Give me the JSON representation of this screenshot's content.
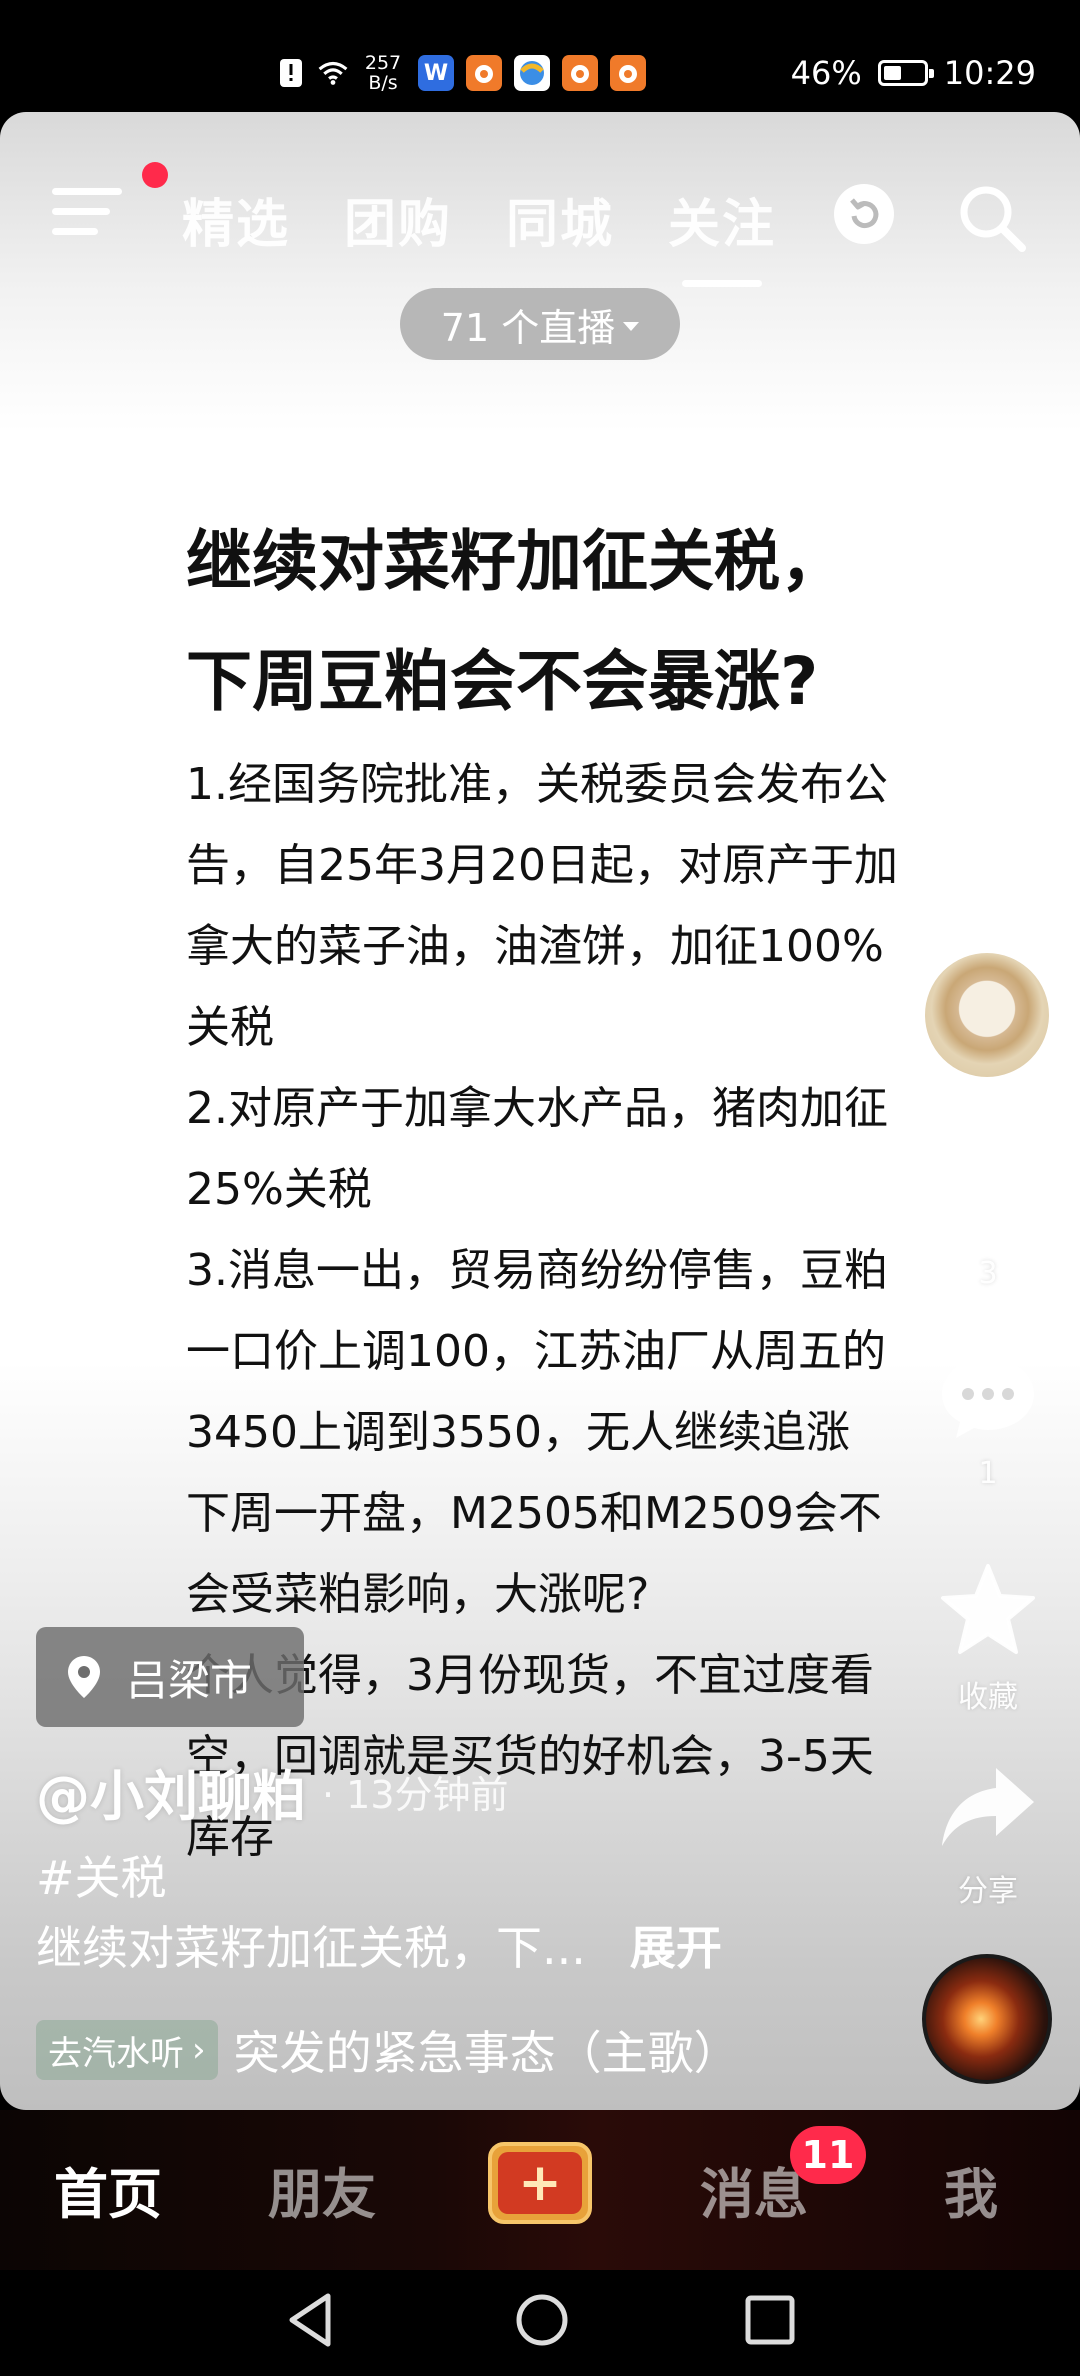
{
  "status_bar": {
    "net_speed_value": "257",
    "net_speed_unit": "B/s",
    "battery": "46%",
    "battery_level": 0.46,
    "time": "10:29",
    "app_icons": [
      "wps-icon",
      "app-icon",
      "browser-icon",
      "app-icon",
      "app-icon"
    ]
  },
  "top_nav": {
    "tabs": [
      {
        "label": "精选"
      },
      {
        "label": "团购"
      },
      {
        "label": "同城"
      },
      {
        "label": "关注"
      }
    ],
    "active_tab": "关注"
  },
  "live_pill": {
    "label": "71 个直播"
  },
  "post": {
    "title_line1": "继续对菜籽加征关税，",
    "title_line2": "下周豆粕会不会暴涨?",
    "body": [
      "1.经国务院批准，关税委员会发布公告，自25年3月20日起，对原产于加拿大的菜子油，油渣饼，加征100%关税",
      "2.对原产于加拿大水产品，猪肉加征25%关税",
      "3.消息一出，贸易商纷纷停售，豆粕一口价上调100，江苏油厂从周五的3450上调到3550，无人继续追涨",
      "下周一开盘，M2505和M2509会不会受菜粕影响，大涨呢?",
      "个人觉得，3月份现货，不宜过度看空，回调就是买货的好机会，3-5天库存"
    ]
  },
  "rail": {
    "like_count": "3",
    "comment_count": "1",
    "favorite_label": "收藏",
    "share_label": "分享"
  },
  "overlay": {
    "location": "吕梁市",
    "author": "@小刘聊粕",
    "time": "· 13分钟前",
    "hashtag": "#关税",
    "caption": "继续对菜籽加征关税，下...",
    "expand": "展开",
    "car_chip": "去汽水听",
    "song": "突发的紧急事态（主歌）"
  },
  "bottom_nav": {
    "items": [
      {
        "label": "首页"
      },
      {
        "label": "朋友"
      },
      {
        "label": "消息"
      },
      {
        "label": "我"
      }
    ],
    "active": "首页",
    "message_badge": "11"
  }
}
